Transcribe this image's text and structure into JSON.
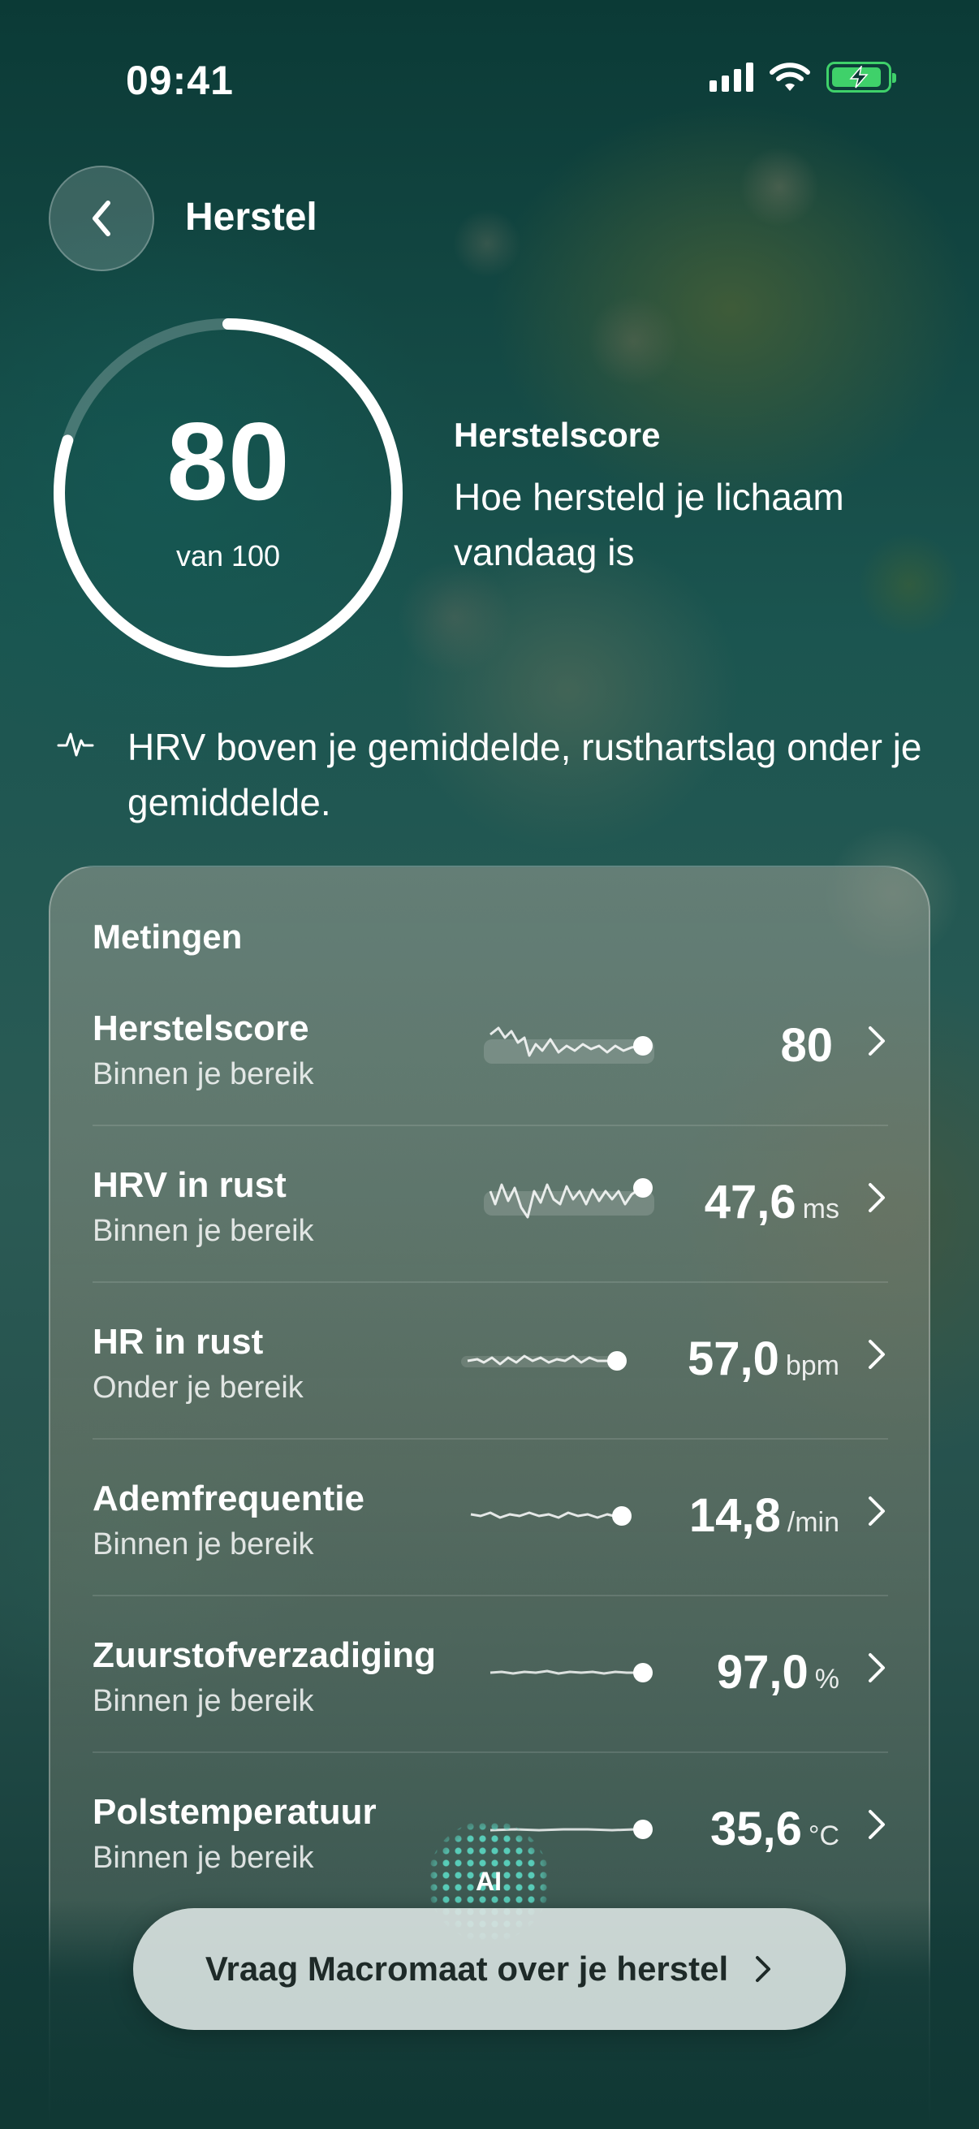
{
  "status_bar": {
    "time": "09:41"
  },
  "header": {
    "title": "Herstel"
  },
  "score": {
    "value": "80",
    "max_label": "van 100",
    "fraction": 0.8,
    "label": "Herstelscore",
    "description": "Hoe hersteld je lichaam vandaag is"
  },
  "insight": {
    "text": "HRV boven je gemiddelde, rusthartslag onder je gemiddelde."
  },
  "metrics": {
    "title": "Metingen",
    "rows": [
      {
        "name": "Herstelscore",
        "status": "Binnen je bereik",
        "value": "80",
        "unit": ""
      },
      {
        "name": "HRV in rust",
        "status": "Binnen je bereik",
        "value": "47,6",
        "unit": "ms"
      },
      {
        "name": "HR in rust",
        "status": "Onder je bereik",
        "value": "57,0",
        "unit": "bpm"
      },
      {
        "name": "Ademfrequentie",
        "status": "Binnen je bereik",
        "value": "14,8",
        "unit": "/min"
      },
      {
        "name": "Zuurstofverzadiging",
        "status": "Binnen je bereik",
        "value": "97,0",
        "unit": "%"
      },
      {
        "name": "Polstemperatuur",
        "status": "Binnen je bereik",
        "value": "35,6",
        "unit": "°C"
      }
    ]
  },
  "ai": {
    "badge": "AI"
  },
  "ask_button": {
    "label": "Vraag Macromaat over je herstel"
  },
  "colors": {
    "battery": "#3fd16a",
    "ai_dots": "#5ad2be"
  }
}
